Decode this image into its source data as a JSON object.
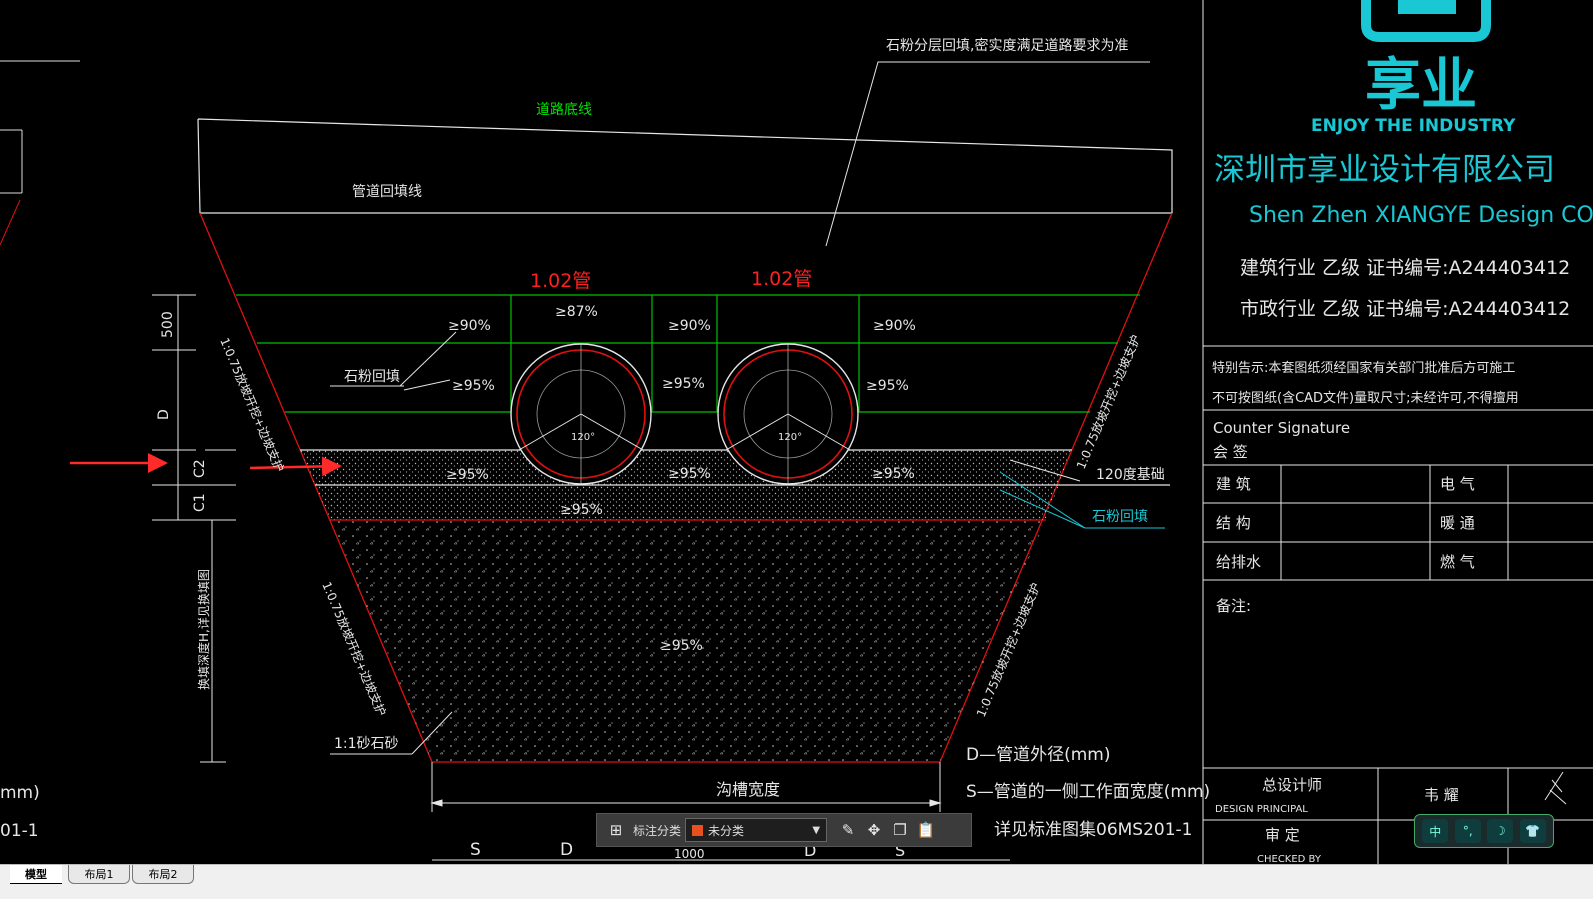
{
  "drawing": {
    "top_note": "石粉分层回填,密实度满足道路要求为准",
    "road_bed_line": "道路底线",
    "pipe_backfill_line": "管道回填线",
    "pipe_label_1": "1.02管",
    "pipe_label_2": "1.02管",
    "pct_87": "≥87%",
    "pct_90_a": "≥90%",
    "pct_90_b": "≥90%",
    "pct_90_c": "≥90%",
    "pct_95_a": "≥95%",
    "pct_95_b": "≥95%",
    "pct_95_c": "≥95%",
    "pct_95_d": "≥95%",
    "pct_95_e": "≥95%",
    "pct_95_f": "≥95%",
    "pct_95_g": "≥95%",
    "pct_95_h": "≥95%",
    "angle_1": "120°",
    "angle_2": "120°",
    "stone_backfill_left": "石粉回填",
    "base_120": "120度基础",
    "stone_backfill_right": "石粉回填",
    "dim_500": "500",
    "dim_D": "D",
    "dim_C2": "C2",
    "dim_C1": "C1",
    "dim_depth": "换填深度H,详见换填图",
    "slope_left_upper": "1:0.75放坡开挖+边坡支护",
    "slope_right_upper": "1:0.75放坡开挖+边坡支护",
    "slope_left_lower": "1:0.75放坡开挖+边坡支护",
    "slope_right_lower": "1:0.75放坡开挖+边坡支护",
    "sand_gravel": "1:1砂石砂",
    "trench_width": "沟槽宽度",
    "legend_D": "D—管道外径(mm)",
    "legend_S": "S—管道的一侧工作面宽度(mm)",
    "legend_ref": "详见标准图集06MS201-1",
    "left_mm": "mm)",
    "left_ref": "01-1",
    "bottom_S1": "S",
    "bottom_D1": "D",
    "bottom_1000": "1000",
    "bottom_D2": "D",
    "bottom_S2": "S"
  },
  "title_block": {
    "logo_text": "享业",
    "logo_en": "ENJOY THE INDUSTRY",
    "company_cn": "深圳市享业设计有限公司",
    "company_en": "Shen Zhen XIANGYE Design CO.,LT",
    "cert_1": "建筑行业 乙级 证书编号:A244403412",
    "cert_2": "市政行业 乙级 证书编号:A244403412",
    "notice_1": "特别告示:本套图纸须经国家有关部门批准后方可施工",
    "notice_2": "不可按图纸(含CAD文件)量取尺寸;未经许可,不得擅用",
    "counter_sig": "Counter Signature",
    "countersign_cn": "会 签",
    "row1_a": "建 筑",
    "row1_b": "电 气",
    "row2_a": "结 构",
    "row2_b": "暖 通",
    "row3_a": "给排水",
    "row3_b": "燃 气",
    "remarks": "备注:",
    "chief_cn": "总设计师",
    "chief_en": "DESIGN PRINCIPAL",
    "chief_name": "韦 耀",
    "approved_cn": "审 定",
    "approved_en": "CHECKED BY"
  },
  "toolbar": {
    "category_label": "标注分类",
    "category_value": "未分类"
  },
  "ime": {
    "mode": "中"
  },
  "tabs": {
    "model": "模型",
    "layout1": "布局1",
    "layout2": "布局2"
  },
  "colors": {
    "background": "#000000",
    "green_line": "#00c000",
    "red_line": "#e01010",
    "cyan": "#19c8d4"
  }
}
